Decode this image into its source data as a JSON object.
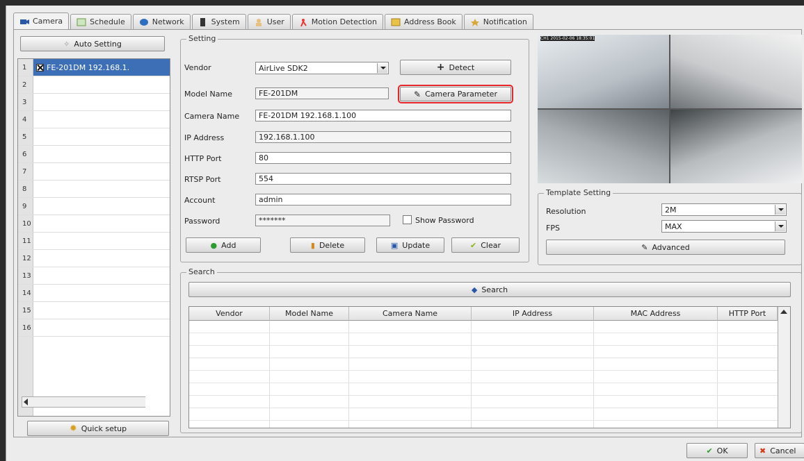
{
  "tabs": [
    {
      "label": "Camera",
      "icon": "camera-icon",
      "active": true
    },
    {
      "label": "Schedule",
      "icon": "schedule-icon"
    },
    {
      "label": "Network",
      "icon": "network-icon"
    },
    {
      "label": "System",
      "icon": "system-icon"
    },
    {
      "label": "User",
      "icon": "user-icon"
    },
    {
      "label": "Motion Detection",
      "icon": "motion-icon"
    },
    {
      "label": "Address Book",
      "icon": "address-book-icon"
    },
    {
      "label": "Notification",
      "icon": "notification-icon"
    }
  ],
  "left": {
    "auto_setting": "Auto Setting",
    "quick_setup": "Quick setup",
    "cameras": [
      {
        "num": "1",
        "name": "FE-201DM 192.168.1."
      },
      {
        "num": "2",
        "name": ""
      },
      {
        "num": "3",
        "name": ""
      },
      {
        "num": "4",
        "name": ""
      },
      {
        "num": "5",
        "name": ""
      },
      {
        "num": "6",
        "name": ""
      },
      {
        "num": "7",
        "name": ""
      },
      {
        "num": "8",
        "name": ""
      },
      {
        "num": "9",
        "name": ""
      },
      {
        "num": "10",
        "name": ""
      },
      {
        "num": "11",
        "name": ""
      },
      {
        "num": "12",
        "name": ""
      },
      {
        "num": "13",
        "name": ""
      },
      {
        "num": "14",
        "name": ""
      },
      {
        "num": "15",
        "name": ""
      },
      {
        "num": "16",
        "name": ""
      }
    ]
  },
  "setting": {
    "group": "Setting",
    "vendor_label": "Vendor",
    "vendor_value": "AirLive SDK2",
    "detect": "Detect",
    "model_label": "Model Name",
    "model_value": "FE-201DM",
    "camera_parameter": "Camera Parameter",
    "camera_name_label": "Camera Name",
    "camera_name_value": "FE-201DM 192.168.1.100",
    "ip_label": "IP Address",
    "ip_value": "192.168.1.100",
    "http_label": "HTTP Port",
    "http_value": "80",
    "rtsp_label": "RTSP Port",
    "rtsp_value": "554",
    "account_label": "Account",
    "account_value": "admin",
    "password_label": "Password",
    "password_value": "*******",
    "show_password": "Show Password",
    "add": "Add",
    "delete": "Delete",
    "update": "Update",
    "clear": "Clear"
  },
  "preview": {
    "timestamp": "CH1 2015-02-06 18:35:01"
  },
  "template": {
    "group": "Template Setting",
    "resolution_label": "Resolution",
    "resolution_value": "2M",
    "fps_label": "FPS",
    "fps_value": "MAX",
    "advanced": "Advanced"
  },
  "search": {
    "group": "Search",
    "button": "Search",
    "columns": [
      "Vendor",
      "Model Name",
      "Camera Name",
      "IP Address",
      "MAC Address",
      "HTTP Port"
    ]
  },
  "footer": {
    "ok": "OK",
    "cancel": "Cancel"
  },
  "colors": {
    "selection": "#3d6fb6",
    "highlight": "#e8262a",
    "ok_check": "#2e9b2e",
    "cancel_x": "#d43a1a"
  }
}
